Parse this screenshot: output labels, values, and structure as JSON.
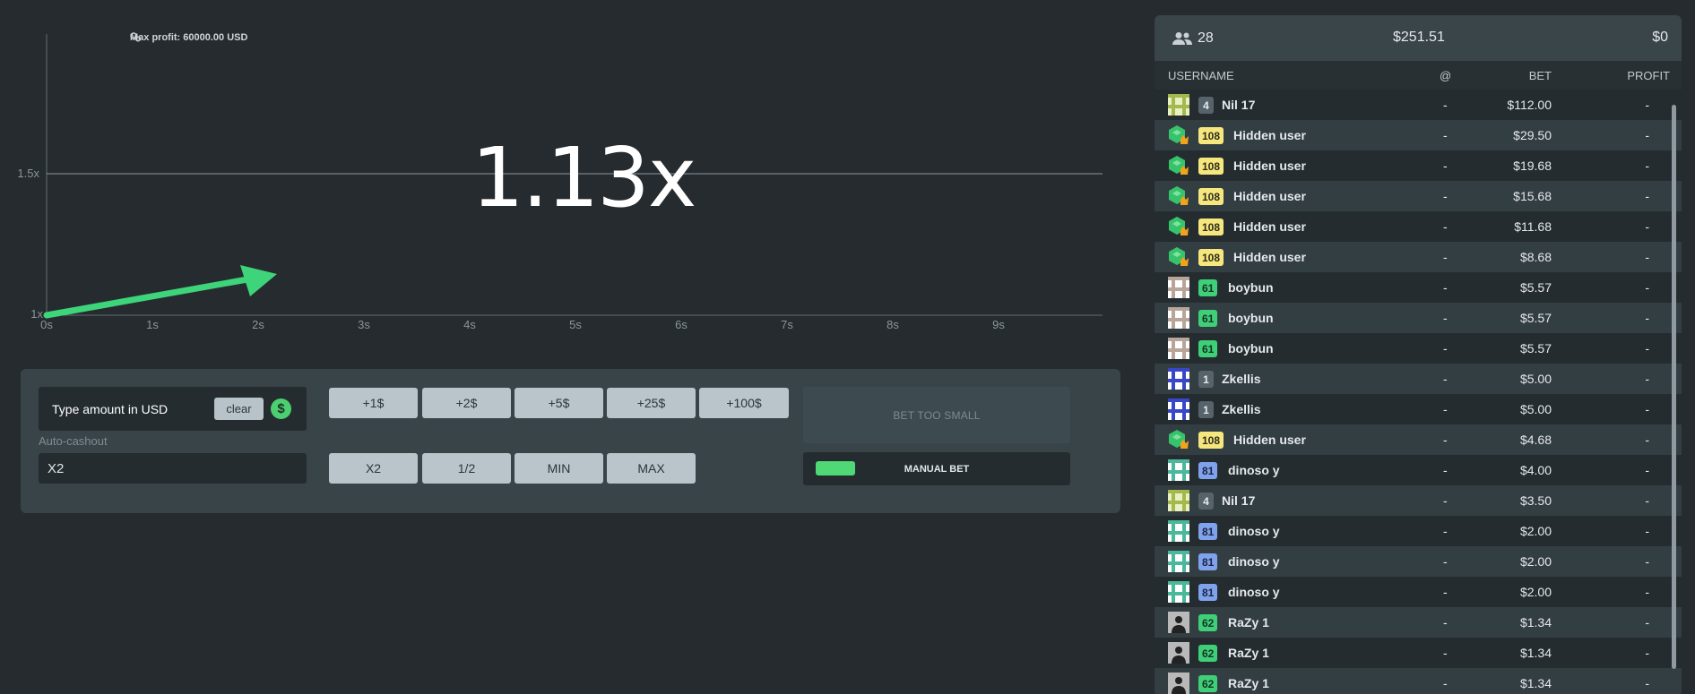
{
  "graph": {
    "max_profit": "Max profit: 60000.00 USD",
    "multiplier": "1.13x",
    "y_ticks": [
      "1.5x",
      "1x"
    ],
    "x_ticks": [
      "0s",
      "1s",
      "2s",
      "3s",
      "4s",
      "5s",
      "6s",
      "7s",
      "8s",
      "9s"
    ],
    "curve_color": "#3ed47a"
  },
  "controls": {
    "amount_placeholder": "Type amount in USD",
    "clear_label": "clear",
    "currency_symbol": "$",
    "autocashout_label": "Auto-cashout",
    "autocashout_value": "X2",
    "add_buttons": [
      "+1$",
      "+2$",
      "+5$",
      "+25$",
      "+100$"
    ],
    "mod_buttons": [
      "X2",
      "1/2",
      "MIN",
      "MAX"
    ],
    "bet_status": "BET TOO SMALL",
    "manual_bet_label": "MANUAL BET"
  },
  "players": {
    "count": "28",
    "total_bet": "$251.51",
    "total_profit": "$0",
    "columns": {
      "username": "USERNAME",
      "at": "@",
      "bet": "BET",
      "profit": "PROFIT"
    },
    "rows": [
      {
        "avatar": "pattern-olive",
        "level": "4",
        "level_style": "grey",
        "name": "Nil 17",
        "at": "-",
        "bet": "$112.00",
        "profit": "-"
      },
      {
        "avatar": "hidden",
        "level": "108",
        "level_style": "yellow",
        "name": "Hidden user",
        "at": "-",
        "bet": "$29.50",
        "profit": "-"
      },
      {
        "avatar": "hidden",
        "level": "108",
        "level_style": "yellow",
        "name": "Hidden user",
        "at": "-",
        "bet": "$19.68",
        "profit": "-"
      },
      {
        "avatar": "hidden",
        "level": "108",
        "level_style": "yellow",
        "name": "Hidden user",
        "at": "-",
        "bet": "$15.68",
        "profit": "-"
      },
      {
        "avatar": "hidden",
        "level": "108",
        "level_style": "yellow",
        "name": "Hidden user",
        "at": "-",
        "bet": "$11.68",
        "profit": "-"
      },
      {
        "avatar": "hidden",
        "level": "108",
        "level_style": "yellow",
        "name": "Hidden user",
        "at": "-",
        "bet": "$8.68",
        "profit": "-"
      },
      {
        "avatar": "pattern-white",
        "level": "61",
        "level_style": "green",
        "name": "boybun",
        "at": "-",
        "bet": "$5.57",
        "profit": "-"
      },
      {
        "avatar": "pattern-white",
        "level": "61",
        "level_style": "green",
        "name": "boybun",
        "at": "-",
        "bet": "$5.57",
        "profit": "-"
      },
      {
        "avatar": "pattern-white",
        "level": "61",
        "level_style": "green",
        "name": "boybun",
        "at": "-",
        "bet": "$5.57",
        "profit": "-"
      },
      {
        "avatar": "pattern-blue",
        "level": "1",
        "level_style": "grey",
        "name": "Zkellis",
        "at": "-",
        "bet": "$5.00",
        "profit": "-"
      },
      {
        "avatar": "pattern-blue",
        "level": "1",
        "level_style": "grey",
        "name": "Zkellis",
        "at": "-",
        "bet": "$5.00",
        "profit": "-"
      },
      {
        "avatar": "hidden",
        "level": "108",
        "level_style": "yellow",
        "name": "Hidden user",
        "at": "-",
        "bet": "$4.68",
        "profit": "-"
      },
      {
        "avatar": "pattern-teal",
        "level": "81",
        "level_style": "blue",
        "name": "dinoso y",
        "at": "-",
        "bet": "$4.00",
        "profit": "-"
      },
      {
        "avatar": "pattern-olive",
        "level": "4",
        "level_style": "grey",
        "name": "Nil 17",
        "at": "-",
        "bet": "$3.50",
        "profit": "-"
      },
      {
        "avatar": "pattern-teal",
        "level": "81",
        "level_style": "blue",
        "name": "dinoso y",
        "at": "-",
        "bet": "$2.00",
        "profit": "-"
      },
      {
        "avatar": "pattern-teal",
        "level": "81",
        "level_style": "blue",
        "name": "dinoso y",
        "at": "-",
        "bet": "$2.00",
        "profit": "-"
      },
      {
        "avatar": "pattern-teal",
        "level": "81",
        "level_style": "blue",
        "name": "dinoso y",
        "at": "-",
        "bet": "$2.00",
        "profit": "-"
      },
      {
        "avatar": "photo",
        "level": "62",
        "level_style": "green",
        "name": "RaZy 1",
        "at": "-",
        "bet": "$1.34",
        "profit": "-"
      },
      {
        "avatar": "photo",
        "level": "62",
        "level_style": "green",
        "name": "RaZy 1",
        "at": "-",
        "bet": "$1.34",
        "profit": "-"
      },
      {
        "avatar": "photo",
        "level": "62",
        "level_style": "green",
        "name": "RaZy 1",
        "at": "-",
        "bet": "$1.34",
        "profit": "-"
      }
    ]
  }
}
